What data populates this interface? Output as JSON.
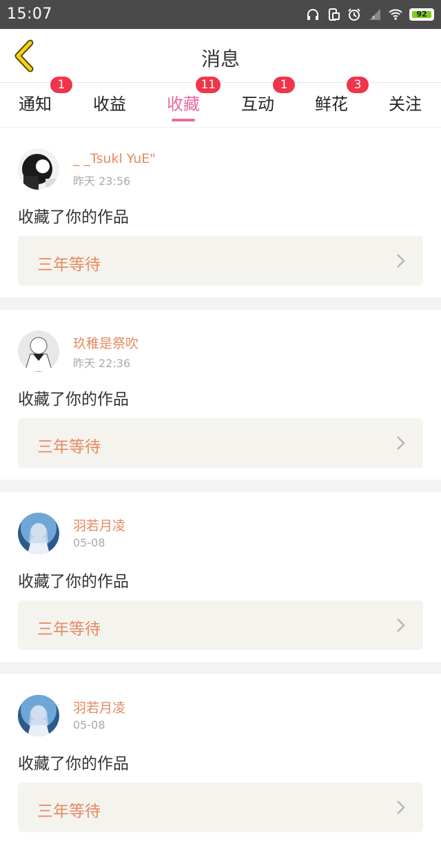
{
  "status_bar": {
    "time": "15:07",
    "battery": "92"
  },
  "header": {
    "title": "消息"
  },
  "tabs": [
    {
      "label": "通知",
      "badge": "1"
    },
    {
      "label": "收益",
      "badge": ""
    },
    {
      "label": "收藏",
      "badge": "11",
      "active": true
    },
    {
      "label": "互动",
      "badge": "1"
    },
    {
      "label": "鲜花",
      "badge": "3"
    },
    {
      "label": "关注",
      "badge": ""
    }
  ],
  "feed": [
    {
      "user": "_ _Tsukl YuE\"",
      "time": "昨天 23:56",
      "action": "收藏了你的作品",
      "work": "三年等待"
    },
    {
      "user": "玖稚是祭吹",
      "time": "昨天 22:36",
      "action": "收藏了你的作品",
      "work": "三年等待"
    },
    {
      "user": "羽若月凌",
      "time": "05-08",
      "action": "收藏了你的作品",
      "work": "三年等待"
    },
    {
      "user": "羽若月凌",
      "time": "05-08",
      "action": "收藏了你的作品",
      "work": "三年等待"
    }
  ],
  "colors": {
    "accent_pink": "#e96a9e",
    "name_orange": "#e5895e",
    "badge_red": "#f0344a",
    "back_yellow": "#f4d21f"
  }
}
